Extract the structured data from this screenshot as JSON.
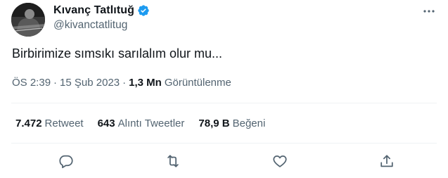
{
  "author": {
    "display_name": "Kıvanç Tatlıtuğ",
    "handle": "@kivanctatlitug"
  },
  "tweet": {
    "text": "Birbirimize sımsıkı sarılalım olur mu...",
    "time": "ÖS 2:39",
    "separator": "·",
    "date": "15 Şub 2023",
    "views_count": "1,3 Mn",
    "views_label": "Görüntülenme"
  },
  "stats": {
    "retweets_count": "7.472",
    "retweets_label": "Retweet",
    "quotes_count": "643",
    "quotes_label": "Alıntı Tweetler",
    "likes_count": "78,9 B",
    "likes_label": "Beğeni"
  },
  "icons": {
    "verified": "verified-badge-icon",
    "more": "more-icon",
    "reply": "reply-icon",
    "retweet": "retweet-icon",
    "like": "like-icon",
    "share": "share-icon"
  },
  "colors": {
    "primary_text": "#0f1419",
    "secondary_text": "#536471",
    "verified_blue": "#1d9bf0",
    "divider": "#eff3f4"
  }
}
